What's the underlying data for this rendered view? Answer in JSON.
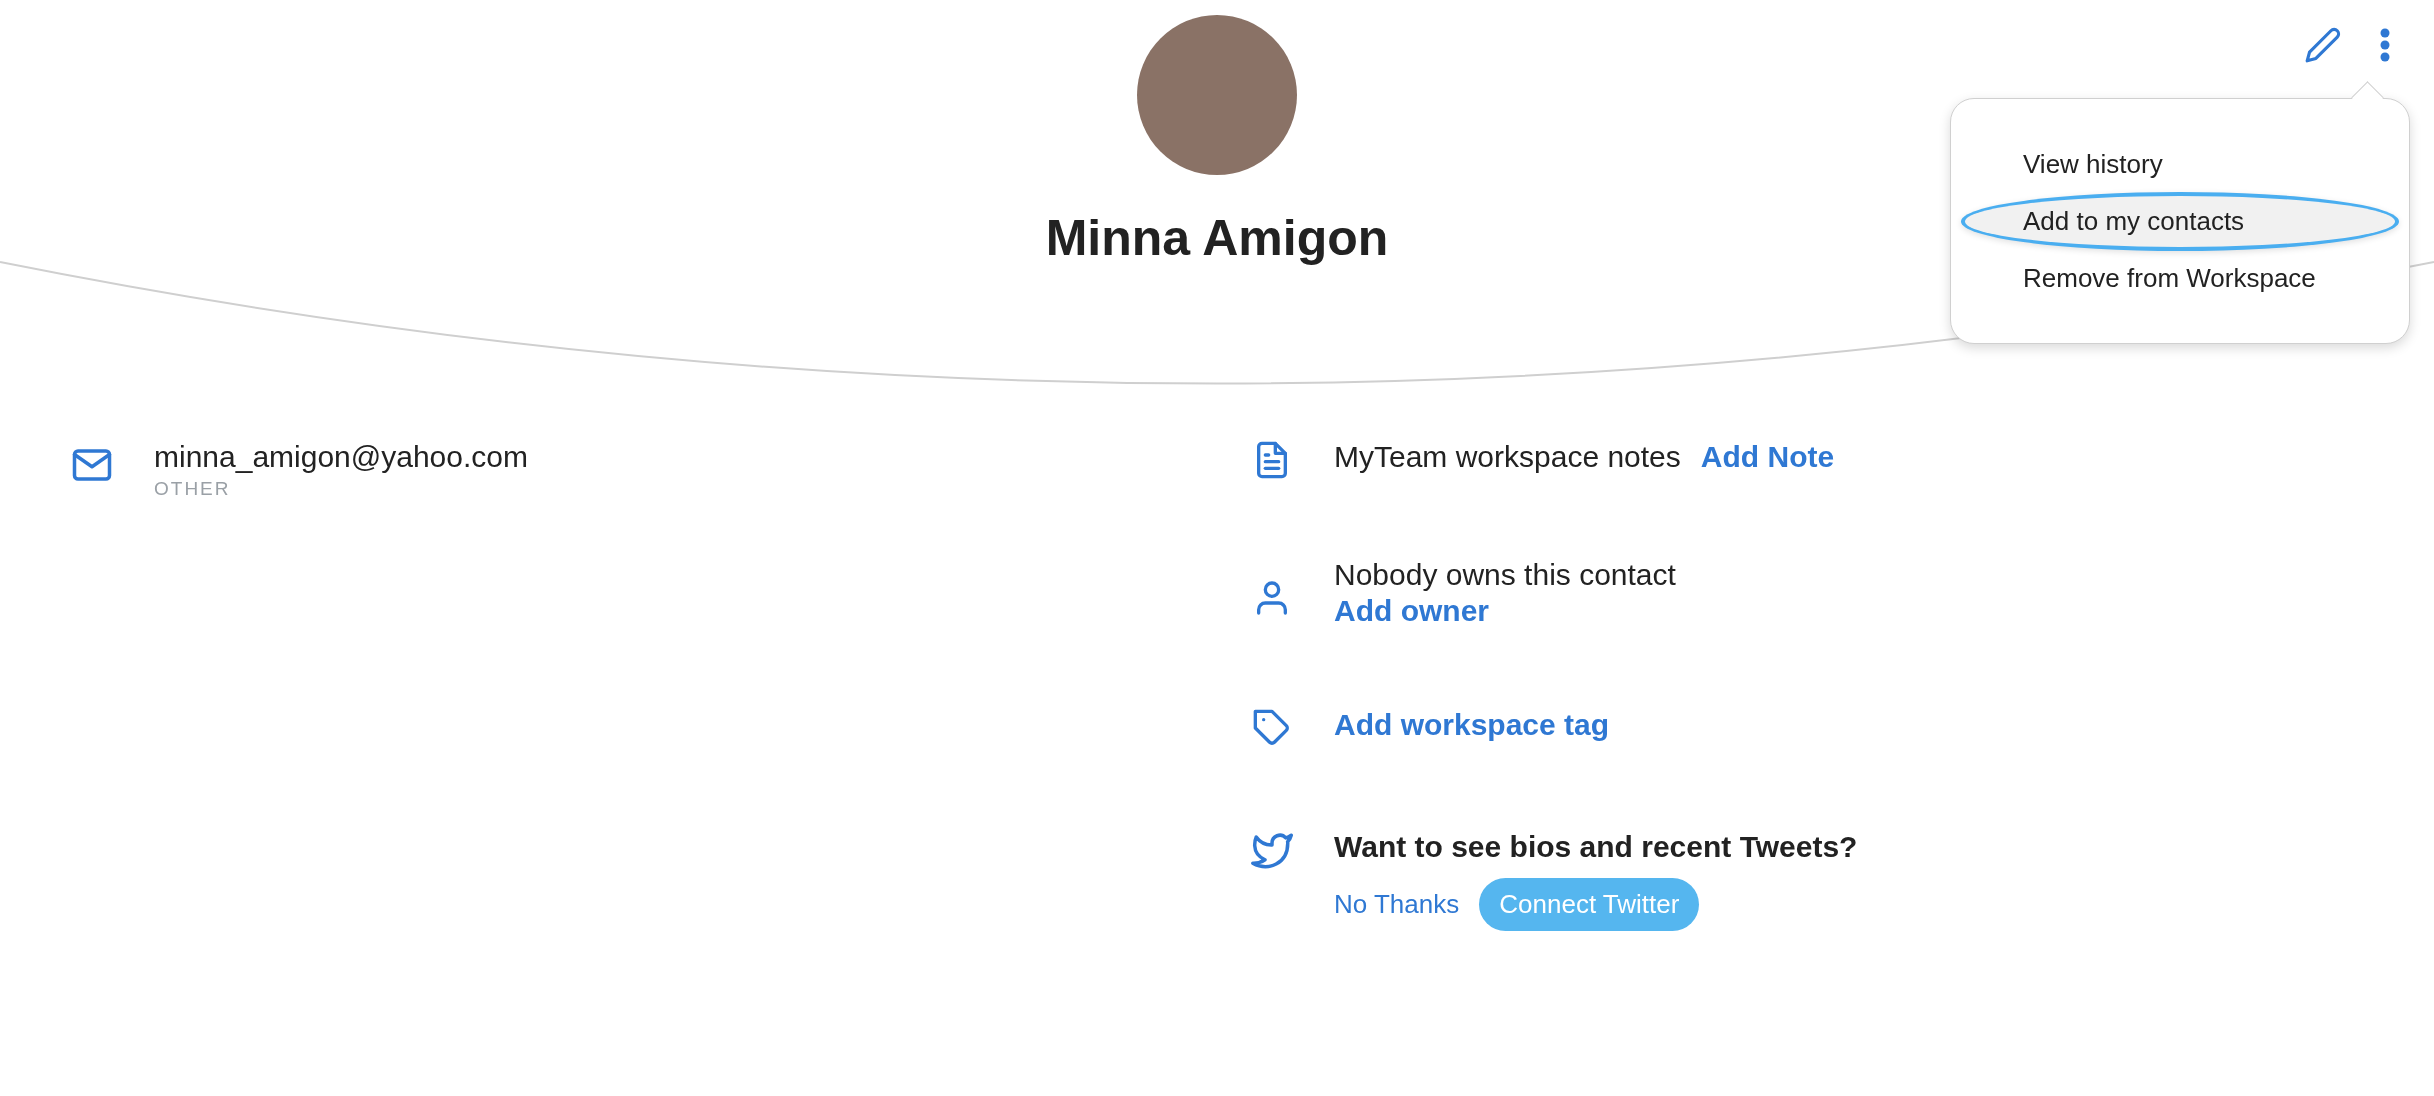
{
  "contact": {
    "name": "Minna Amigon"
  },
  "menu": {
    "items": [
      {
        "label": "View history",
        "selected": false
      },
      {
        "label": "Add to my contacts",
        "selected": true
      },
      {
        "label": "Remove from Workspace",
        "selected": false
      }
    ]
  },
  "email": {
    "address": "minna_amigon@yahoo.com",
    "label": "OTHER"
  },
  "details": [
    {
      "kind": "note",
      "text": "MyTeam workspace notes",
      "link": "Add Note"
    },
    {
      "kind": "owner",
      "text": "Nobody owns this contact",
      "link": "Add owner"
    },
    {
      "kind": "tag",
      "link": "Add workspace tag"
    },
    {
      "kind": "twitter",
      "text": "Want to see bios and recent Tweets?",
      "secondary": "No Thanks",
      "button": "Connect Twitter"
    }
  ]
}
